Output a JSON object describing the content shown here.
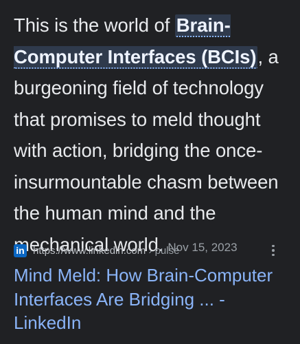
{
  "snippet": {
    "lead": "This is the world of ",
    "highlight": "Brain-Computer Interfaces (BCIs)",
    "rest": ", a burgeoning field of technology that promises to meld thought with action, bridging the once-insurmountable chasm between the human mind and the mechanical world.",
    "date": "Nov 15, 2023"
  },
  "source": {
    "favicon_letters": "in",
    "favicon_color": "#0a66c2",
    "url": "https://www.linkedin.com",
    "breadcrumb": " › pulse",
    "icon": "linkedin-icon"
  },
  "result": {
    "title": "Mind Meld: How Brain-Computer Interfaces Are Bridging ... - LinkedIn",
    "link_color": "#8ab4f8"
  },
  "colors": {
    "background": "#202124",
    "text": "#e8eaed",
    "muted": "#9aa0a6"
  }
}
